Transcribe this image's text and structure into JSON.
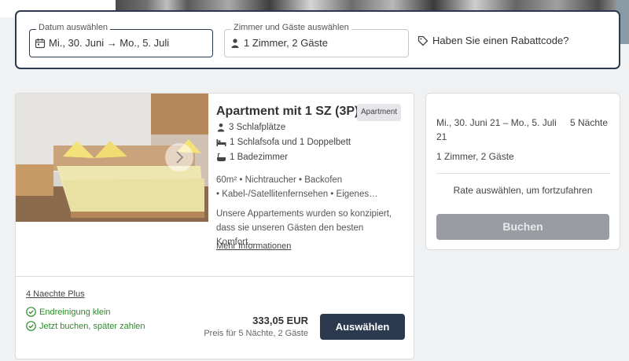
{
  "search": {
    "date_label": "Datum auswählen",
    "date_value": "Mi., 30. Juni → Mo., 5. Juli",
    "guests_label": "Zimmer und Gäste auswählen",
    "guests_value": "1 Zimmer, 2 Gäste",
    "promo_label": "Haben Sie einen Rabattcode?",
    "icons": {
      "date": "calendar-icon",
      "guests": "person-icon",
      "promo": "tag-icon"
    }
  },
  "room": {
    "title": "Apartment mit 1 SZ (3P)",
    "type_badge": "Apartment",
    "features": [
      "3 Schlafplätze",
      "1 Schlafsofa und 1 Doppelbett",
      "1 Badezimmer"
    ],
    "amenities_line1": "60m² • Nichtraucher • Backofen",
    "amenities_line2": "• Kabel-/Satellitenfernsehen • Eigenes…",
    "description": "Unsere Appartements wurden so konzipiert, dass sie unseren Gästen den besten Komfort…",
    "more_link": "Mehr Informationen",
    "rate": {
      "name": "4 Naechte Plus",
      "perks": [
        "Endreinigung klein",
        "Jetzt buchen, später zahlen"
      ],
      "price": "333,05 EUR",
      "price_note": "Preis für 5 Nächte, 2 Gäste",
      "select_label": "Auswählen"
    }
  },
  "summary": {
    "dates": "Mi., 30. Juni 21 – Mo., 5. Juli 21",
    "nights": "5 Nächte",
    "guests": "1 Zimmer, 2 Gäste",
    "hint": "Rate auswählen, um fortzufahren",
    "book_label": "Buchen"
  },
  "colors": {
    "primary": "#2b3a4f",
    "success": "#2e8b2e",
    "disabled": "#999da3"
  }
}
